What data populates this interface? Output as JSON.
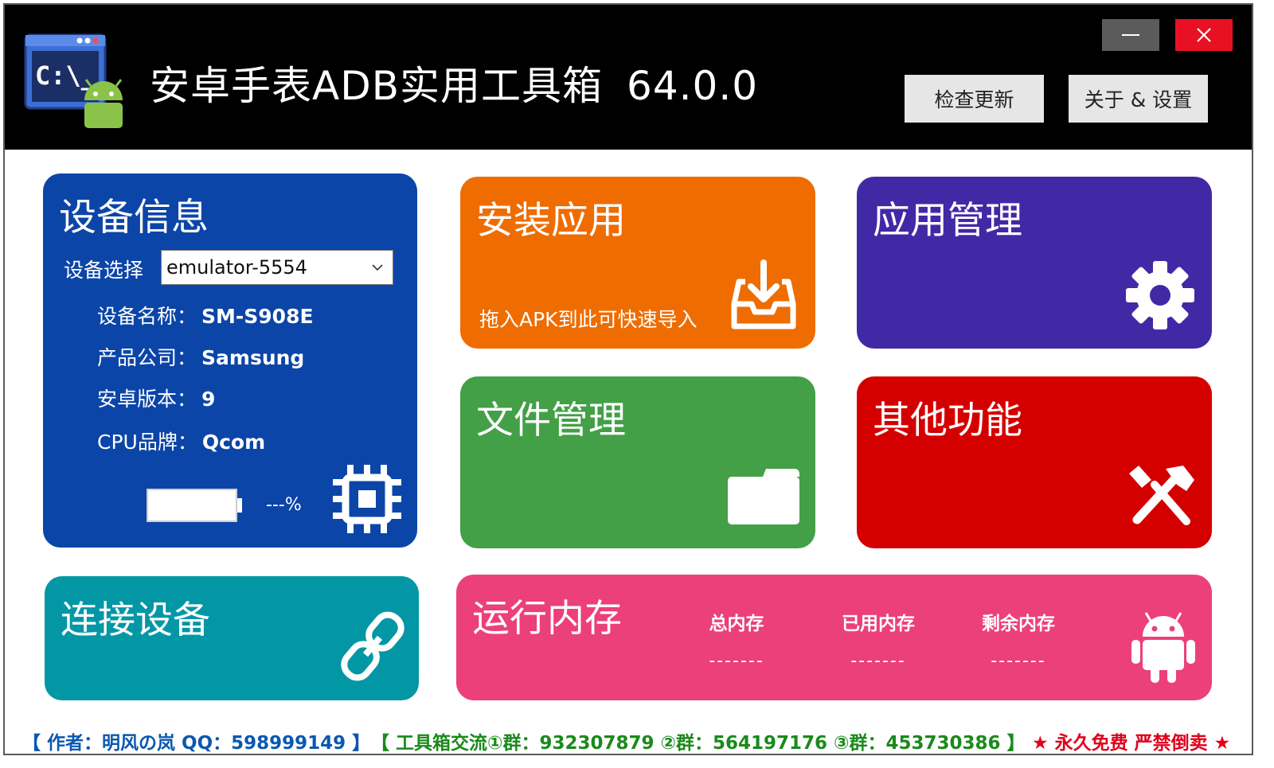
{
  "window": {
    "title": "安卓手表ADB实用工具箱",
    "version": "64.0.0",
    "check_update": "检查更新",
    "about_settings": "关于 & 设置"
  },
  "device_info": {
    "title": "设备信息",
    "select_label": "设备选择",
    "selected_device": "emulator-5554",
    "rows": [
      {
        "label": "设备名称：",
        "value": "SM-S908E"
      },
      {
        "label": "产品公司：",
        "value": "Samsung"
      },
      {
        "label": "安卓版本：",
        "value": "9"
      },
      {
        "label": "CPU品牌：",
        "value": "Qcom"
      }
    ],
    "battery_text": "---%",
    "icon": "cpu-chip-icon"
  },
  "install": {
    "title": "安装应用",
    "hint": "拖入APK到此可快速导入",
    "icon": "inbox-download-icon"
  },
  "app_manage": {
    "title": "应用管理",
    "icon": "gear-icon"
  },
  "file_manage": {
    "title": "文件管理",
    "icon": "folder-icon"
  },
  "other": {
    "title": "其他功能",
    "icon": "tools-icon"
  },
  "connect": {
    "title": "连接设备",
    "icon": "link-icon"
  },
  "memory": {
    "title": "运行内存",
    "columns": [
      {
        "label": "总内存",
        "value": "-------"
      },
      {
        "label": "已用内存",
        "value": "-------"
      },
      {
        "label": "剩余内存",
        "value": "-------"
      }
    ],
    "icon": "android-icon"
  },
  "footer": {
    "author": "【 作者：明风の岚  QQ：598999149 】",
    "groups": "【 工具箱交流①群：932307879  ②群：564197176  ③群：453730386 】",
    "free": "★ 永久免费 严禁倒卖 ★"
  },
  "colors": {
    "device": "#0c45a8",
    "install": "#ef6c00",
    "app_manage": "#4129a6",
    "file_manage": "#43a047",
    "other": "#d40000",
    "connect": "#0397a6",
    "memory": "#ec407a"
  }
}
